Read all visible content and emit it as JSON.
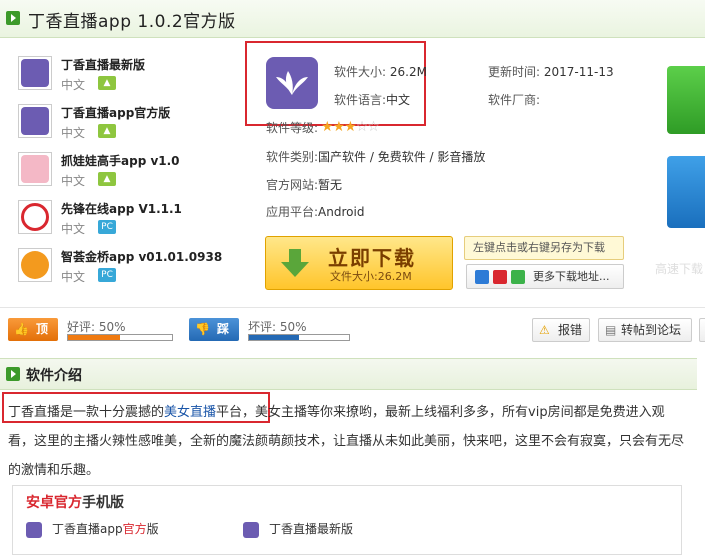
{
  "header": {
    "title": "丁香直播app 1.0.2官方版"
  },
  "related": [
    {
      "name": "丁香直播最新版",
      "lang": "中文",
      "platform": "android"
    },
    {
      "name": "丁香直播app官方版",
      "lang": "中文",
      "platform": "android"
    },
    {
      "name": "抓娃娃高手app v1.0",
      "lang": "中文",
      "platform": "android"
    },
    {
      "name": "先锋在线app V1.1.1",
      "lang": "中文",
      "platform": "pc"
    },
    {
      "name": "智荟金桥app v01.01.0938",
      "lang": "中文",
      "platform": "pc"
    }
  ],
  "platform_labels": {
    "pc": "PC"
  },
  "info": {
    "size_label": "软件大小:",
    "size": "26.2M",
    "update_label": "更新时间:",
    "update": "2017-11-13",
    "lang_label": "软件语言:",
    "lang": "中文",
    "vendor_label": "软件厂商:",
    "rating_label": "软件等级:",
    "rating": 3,
    "rating_max": 5,
    "category_label": "软件类别:",
    "category": "国产软件 / 免费软件 / 影音播放",
    "site_label": "官方网站:",
    "site": "暂无",
    "platform_label": "应用平台:",
    "platform": "Android"
  },
  "download": {
    "main": "立即下载",
    "sub": "文件大小:26.2M",
    "tip": "左键点击或右键另存为下载",
    "more": "更多下载地址..."
  },
  "side": {
    "fast": "高速下载"
  },
  "rating_bar": {
    "up_btn": "顶",
    "up_label": "好评:",
    "up_pct": "50%",
    "up_value": 0.5,
    "down_btn": "踩",
    "down_label": "坏评:",
    "down_pct": "50%",
    "down_value": 0.5,
    "report": "报错",
    "forum": "转帖到论坛"
  },
  "intro": {
    "title": "软件介绍",
    "desc_pre": "丁香直播是一款十分震撼的",
    "desc_link": "美女直播",
    "desc_post": "平台，美女主播等你来撩哟，最新上线福利多多，所有vip房间都是免费进入观看，这里的主播火辣性感唯美，全新的魔法颜萌颜技术，让直播从未如此美丽，快来吧，这里不会有寂寞，只会有无尽的激情和乐趣。"
  },
  "mobile": {
    "title_red": "安卓官方",
    "title_rest": "手机版",
    "items": [
      {
        "pre": "丁香直播app",
        "red": "官方",
        "post": "版"
      },
      {
        "pre": "丁香直播最新版",
        "red": "",
        "post": ""
      }
    ]
  },
  "colors": {
    "accent_green": "#3c9a2a",
    "download_orange": "#ffc52b",
    "link_blue": "#1a55a8",
    "highlight_red": "#d9272f",
    "app_purple": "#6c5cb2"
  }
}
